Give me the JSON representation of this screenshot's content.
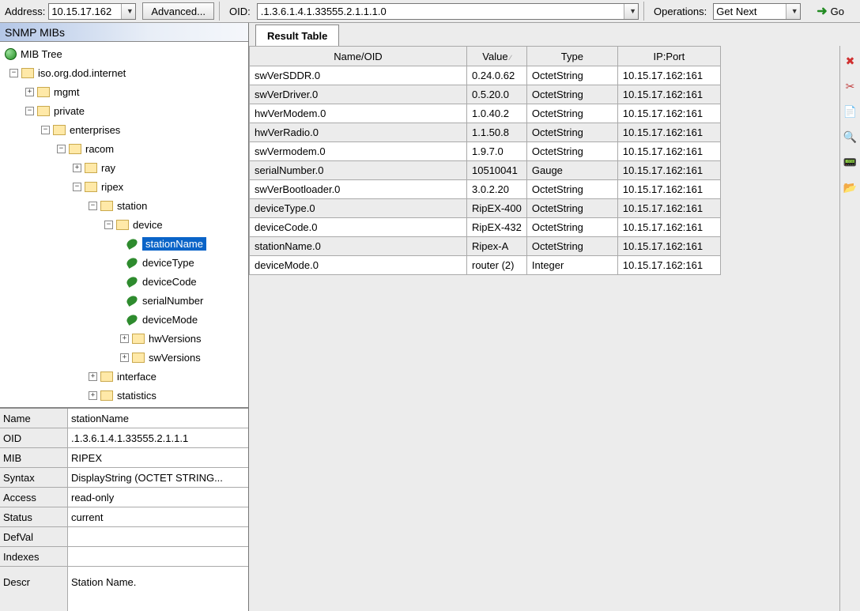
{
  "topbar": {
    "address_label": "Address:",
    "address_value": "10.15.17.162",
    "advanced_label": "Advanced...",
    "oid_label": "OID:",
    "oid_value": ".1.3.6.1.4.1.33555.2.1.1.1.0",
    "operations_label": "Operations:",
    "operations_value": "Get Next",
    "go_label": "Go"
  },
  "mibs_header": "SNMP MIBs",
  "tree": {
    "root": "MIB Tree",
    "iso": "iso.org.dod.internet",
    "mgmt": "mgmt",
    "private": "private",
    "enterprises": "enterprises",
    "racom": "racom",
    "ray": "ray",
    "ripex": "ripex",
    "station": "station",
    "device": "device",
    "stationName": "stationName",
    "deviceType": "deviceType",
    "deviceCode": "deviceCode",
    "serialNumber": "serialNumber",
    "deviceMode": "deviceMode",
    "hwVersions": "hwVersions",
    "swVersions": "swVersions",
    "interface": "interface",
    "statistics": "statistics"
  },
  "details": {
    "Name": "stationName",
    "OID": ".1.3.6.1.4.1.33555.2.1.1.1",
    "MIB": "RIPEX",
    "Syntax": "DisplayString (OCTET STRING...",
    "Access": "read-only",
    "Status": "current",
    "DefVal": "",
    "Indexes": "",
    "Descr": "Station Name."
  },
  "detail_labels": {
    "Name": "Name",
    "OID": "OID",
    "MIB": "MIB",
    "Syntax": "Syntax",
    "Access": "Access",
    "Status": "Status",
    "DefVal": "DefVal",
    "Indexes": "Indexes",
    "Descr": "Descr"
  },
  "tab_label": "Result Table",
  "columns": {
    "name": "Name/OID",
    "value": "Value",
    "type": "Type",
    "ip": "IP:Port"
  },
  "rows": [
    {
      "name": "swVerSDDR.0",
      "value": "0.24.0.62",
      "type": "OctetString",
      "ip": "10.15.17.162:161"
    },
    {
      "name": "swVerDriver.0",
      "value": "0.5.20.0",
      "type": "OctetString",
      "ip": "10.15.17.162:161"
    },
    {
      "name": "hwVerModem.0",
      "value": "1.0.40.2",
      "type": "OctetString",
      "ip": "10.15.17.162:161"
    },
    {
      "name": "hwVerRadio.0",
      "value": "1.1.50.8",
      "type": "OctetString",
      "ip": "10.15.17.162:161"
    },
    {
      "name": "swVermodem.0",
      "value": "1.9.7.0",
      "type": "OctetString",
      "ip": "10.15.17.162:161"
    },
    {
      "name": "serialNumber.0",
      "value": "10510041",
      "type": "Gauge",
      "ip": "10.15.17.162:161"
    },
    {
      "name": "swVerBootloader.0",
      "value": "3.0.2.20",
      "type": "OctetString",
      "ip": "10.15.17.162:161"
    },
    {
      "name": "deviceType.0",
      "value": "RipEX-400",
      "type": "OctetString",
      "ip": "10.15.17.162:161"
    },
    {
      "name": "deviceCode.0",
      "value": "RipEX-432",
      "type": "OctetString",
      "ip": "10.15.17.162:161"
    },
    {
      "name": "stationName.0",
      "value": "Ripex-A",
      "type": "OctetString",
      "ip": "10.15.17.162:161"
    },
    {
      "name": "deviceMode.0",
      "value": "router (2)",
      "type": "Integer",
      "ip": "10.15.17.162:161"
    }
  ],
  "tools": [
    "✖",
    "✂",
    "📄",
    "🔍",
    "📟",
    "📂"
  ]
}
